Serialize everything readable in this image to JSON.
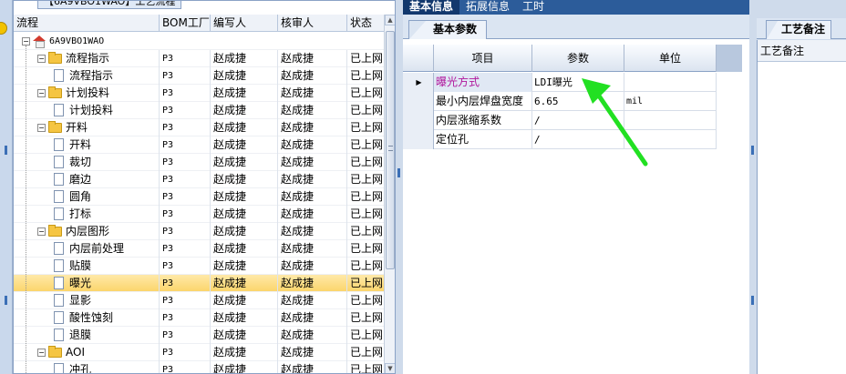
{
  "window": {
    "process_tab": "【6A9VBO1WAO】工艺流程"
  },
  "tree": {
    "columns": [
      "流程",
      "BOM工厂",
      "编写人",
      "核审人",
      "状态"
    ],
    "root": "6A9VBO1WAO",
    "rows": [
      {
        "name": "流程指示",
        "kind": "folder",
        "bom": "P3",
        "writer": "赵成捷",
        "reviewer": "赵成捷",
        "status": "已上网"
      },
      {
        "name": "流程指示",
        "kind": "doc",
        "bom": "P3",
        "writer": "赵成捷",
        "reviewer": "赵成捷",
        "status": "已上网"
      },
      {
        "name": "计划投料",
        "kind": "folder",
        "bom": "P3",
        "writer": "赵成捷",
        "reviewer": "赵成捷",
        "status": "已上网"
      },
      {
        "name": "计划投料",
        "kind": "doc",
        "bom": "P3",
        "writer": "赵成捷",
        "reviewer": "赵成捷",
        "status": "已上网"
      },
      {
        "name": "开料",
        "kind": "folder",
        "bom": "P3",
        "writer": "赵成捷",
        "reviewer": "赵成捷",
        "status": "已上网"
      },
      {
        "name": "开料",
        "kind": "doc",
        "bom": "P3",
        "writer": "赵成捷",
        "reviewer": "赵成捷",
        "status": "已上网"
      },
      {
        "name": "裁切",
        "kind": "doc",
        "bom": "P3",
        "writer": "赵成捷",
        "reviewer": "赵成捷",
        "status": "已上网"
      },
      {
        "name": "磨边",
        "kind": "doc",
        "bom": "P3",
        "writer": "赵成捷",
        "reviewer": "赵成捷",
        "status": "已上网"
      },
      {
        "name": "圆角",
        "kind": "doc",
        "bom": "P3",
        "writer": "赵成捷",
        "reviewer": "赵成捷",
        "status": "已上网"
      },
      {
        "name": "打标",
        "kind": "doc",
        "bom": "P3",
        "writer": "赵成捷",
        "reviewer": "赵成捷",
        "status": "已上网"
      },
      {
        "name": "内层图形",
        "kind": "folder",
        "bom": "P3",
        "writer": "赵成捷",
        "reviewer": "赵成捷",
        "status": "已上网"
      },
      {
        "name": "内层前处理",
        "kind": "doc",
        "bom": "P3",
        "writer": "赵成捷",
        "reviewer": "赵成捷",
        "status": "已上网"
      },
      {
        "name": "贴膜",
        "kind": "doc",
        "bom": "P3",
        "writer": "赵成捷",
        "reviewer": "赵成捷",
        "status": "已上网"
      },
      {
        "name": "曝光",
        "kind": "doc",
        "bom": "P3",
        "writer": "赵成捷",
        "reviewer": "赵成捷",
        "status": "已上网",
        "selected": true
      },
      {
        "name": "显影",
        "kind": "doc",
        "bom": "P3",
        "writer": "赵成捷",
        "reviewer": "赵成捷",
        "status": "已上网"
      },
      {
        "name": "酸性蚀刻",
        "kind": "doc",
        "bom": "P3",
        "writer": "赵成捷",
        "reviewer": "赵成捷",
        "status": "已上网"
      },
      {
        "name": "退膜",
        "kind": "doc",
        "bom": "P3",
        "writer": "赵成捷",
        "reviewer": "赵成捷",
        "status": "已上网"
      },
      {
        "name": "AOI",
        "kind": "folder",
        "bom": "P3",
        "writer": "赵成捷",
        "reviewer": "赵成捷",
        "status": "已上网"
      },
      {
        "name": "冲孔",
        "kind": "doc",
        "bom": "P3",
        "writer": "赵成捷",
        "reviewer": "赵成捷",
        "status": "已上网"
      }
    ]
  },
  "main_tabs": [
    "基本信息",
    "拓展信息",
    "工时"
  ],
  "sub_tab": "基本参数",
  "params_grid": {
    "columns": [
      "项目",
      "参数",
      "单位"
    ],
    "rows": [
      {
        "item": "曝光方式",
        "param": "LDI曝光",
        "unit": "",
        "current": true
      },
      {
        "item": "最小内层焊盘宽度",
        "param": "6.65",
        "unit": "mil"
      },
      {
        "item": "内层涨缩系数",
        "param": "/",
        "unit": ""
      },
      {
        "item": "定位孔",
        "param": "/",
        "unit": ""
      }
    ]
  },
  "right_panel": {
    "tab": "工艺备注",
    "label": "工艺备注"
  },
  "colors": {
    "tab_bar": "#2c5c9a",
    "selected_row": "#fbd56c",
    "annotation_arrow": "#22e022",
    "highlight_text": "#b0169c"
  }
}
